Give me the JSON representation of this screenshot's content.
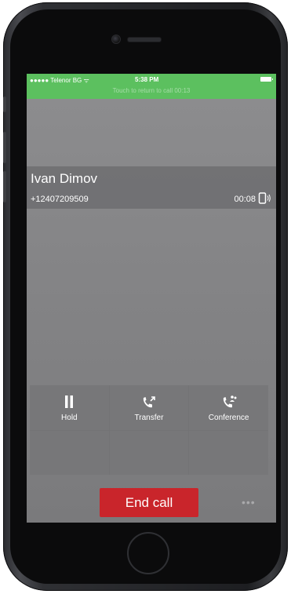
{
  "status_bar": {
    "carrier": "●●●●● Telenor BG ᯤ",
    "time": "5:38 PM",
    "return_banner": "Touch to return to call  00:13"
  },
  "caller": {
    "name": "Ivan Dimov",
    "number": "+12407209509",
    "duration": "00:08"
  },
  "actions": [
    {
      "label": "Hold",
      "icon": "pause-icon"
    },
    {
      "label": "Transfer",
      "icon": "phone-transfer-icon"
    },
    {
      "label": "Conference",
      "icon": "phone-conference-icon"
    }
  ],
  "end_call_label": "End call",
  "more_label": "•••",
  "colors": {
    "status_bar_bg": "#5cc05f",
    "end_call_bg": "#c9252b",
    "screen_bg": "#858587"
  }
}
